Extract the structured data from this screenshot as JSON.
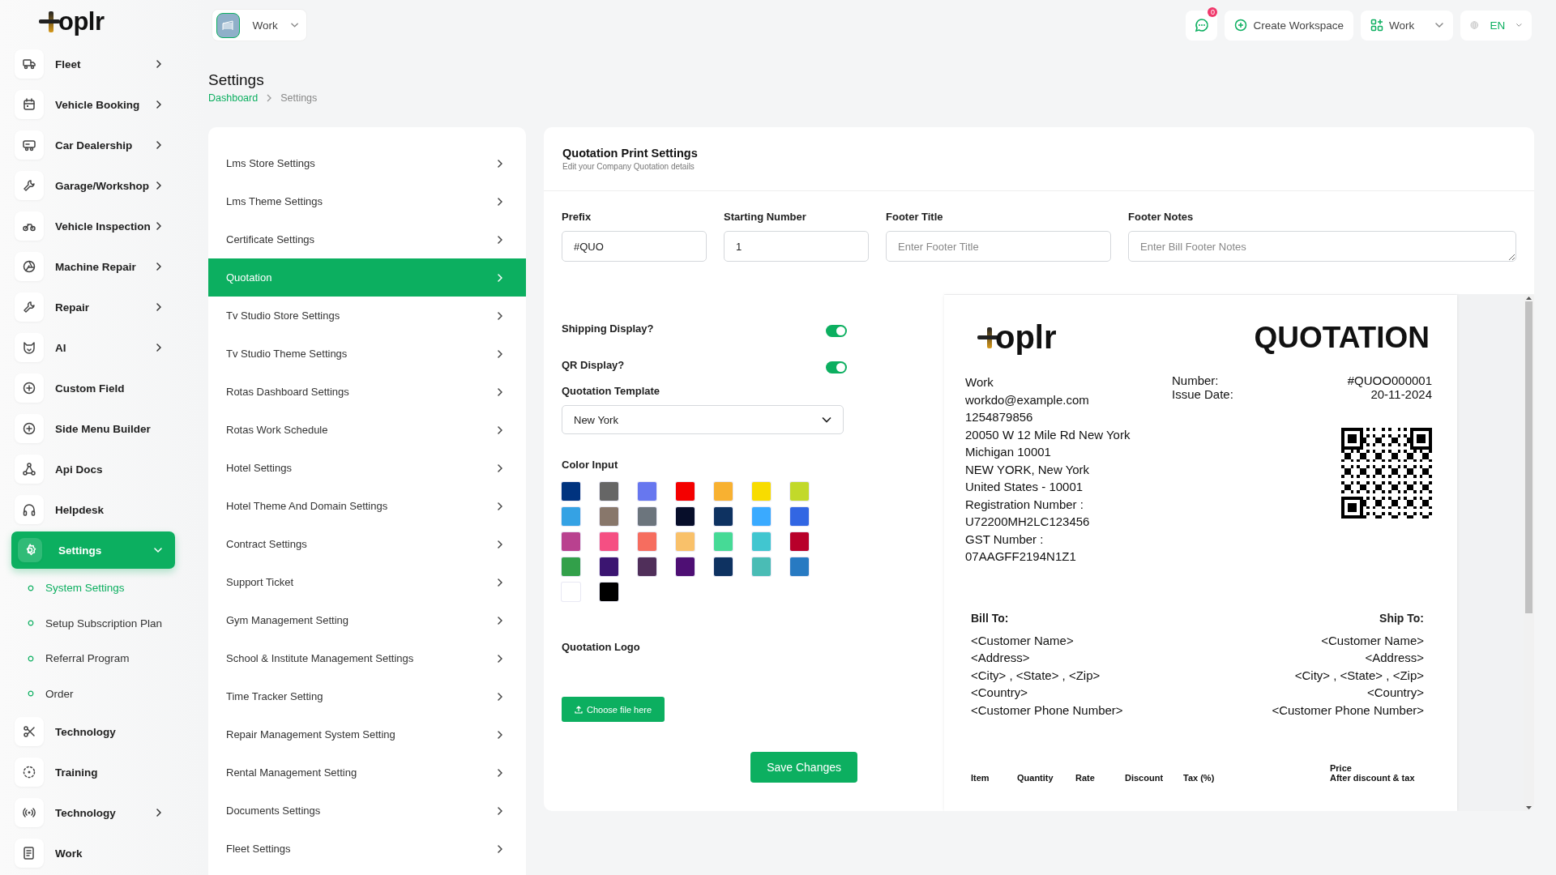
{
  "sidebar": {
    "logo": {
      "text": "oplr"
    },
    "items": [
      {
        "label": "Fleet",
        "kind": "group",
        "selected": false,
        "expanded": false
      },
      {
        "label": "Vehicle Booking",
        "kind": "group",
        "selected": false,
        "expanded": false
      },
      {
        "label": "Car Dealership",
        "kind": "group",
        "selected": false,
        "expanded": false
      },
      {
        "label": "Garage/Workshop",
        "kind": "group",
        "selected": false,
        "expanded": false
      },
      {
        "label": "Vehicle Inspection",
        "kind": "group",
        "selected": false,
        "expanded": false
      },
      {
        "label": "Machine Repair",
        "kind": "group",
        "selected": false,
        "expanded": false
      },
      {
        "label": "Repair",
        "kind": "group",
        "selected": false,
        "expanded": false
      },
      {
        "label": "AI",
        "kind": "group",
        "selected": false,
        "expanded": false
      },
      {
        "label": "Custom Field",
        "kind": "link",
        "selected": false,
        "expanded": false
      },
      {
        "label": "Side Menu Builder",
        "kind": "link",
        "selected": false,
        "expanded": false
      },
      {
        "label": "Api Docs",
        "kind": "link",
        "selected": false,
        "expanded": false
      },
      {
        "label": "Helpdesk",
        "kind": "link",
        "selected": false,
        "expanded": false
      },
      {
        "label": "Settings",
        "kind": "group",
        "selected": true,
        "expanded": true,
        "children": [
          {
            "label": "System Settings",
            "selected": true
          },
          {
            "label": "Setup Subscription Plan",
            "selected": false
          },
          {
            "label": "Referral Program",
            "selected": false
          },
          {
            "label": "Order",
            "selected": false
          }
        ]
      },
      {
        "label": "Technology",
        "kind": "link",
        "selected": false,
        "expanded": false
      },
      {
        "label": "Training",
        "kind": "link",
        "selected": false,
        "expanded": false
      },
      {
        "label": "Technology",
        "kind": "group",
        "selected": false,
        "expanded": false
      },
      {
        "label": "Work",
        "kind": "link",
        "selected": false,
        "expanded": false
      }
    ]
  },
  "top_bar": {
    "workspace": "Work",
    "notifications": "0",
    "create_button": "Create Workspace",
    "workspace_menu": "Work",
    "language": "EN"
  },
  "page": {
    "title": "Settings",
    "breadcrumb": [
      "Dashboard",
      "Settings"
    ]
  },
  "settings_menu": [
    {
      "label": "Lms Store Settings",
      "selected": false
    },
    {
      "label": "Lms Theme Settings",
      "selected": false
    },
    {
      "label": "Certificate Settings",
      "selected": false
    },
    {
      "label": "Quotation",
      "selected": true
    },
    {
      "label": "Tv Studio Store Settings",
      "selected": false
    },
    {
      "label": "Tv Studio Theme Settings",
      "selected": false
    },
    {
      "label": "Rotas Dashboard Settings",
      "selected": false
    },
    {
      "label": "Rotas Work Schedule",
      "selected": false
    },
    {
      "label": "Hotel Settings",
      "selected": false
    },
    {
      "label": "Hotel Theme And Domain Settings",
      "selected": false
    },
    {
      "label": "Contract Settings",
      "selected": false
    },
    {
      "label": "Support Ticket",
      "selected": false
    },
    {
      "label": "Gym Management Setting",
      "selected": false
    },
    {
      "label": "School & Institute Management Settings",
      "selected": false
    },
    {
      "label": "Time Tracker Setting",
      "selected": false
    },
    {
      "label": "Repair Management System Setting",
      "selected": false
    },
    {
      "label": "Rental Management Setting",
      "selected": false
    },
    {
      "label": "Documents Settings",
      "selected": false
    },
    {
      "label": "Fleet Settings",
      "selected": false
    }
  ],
  "card": {
    "title": "Quotation Print Settings",
    "subtitle": "Edit your Company Quotation details",
    "fields": [
      {
        "label": "Prefix",
        "value": "#QUO",
        "kind": "input"
      },
      {
        "label": "Starting Number",
        "value": "1",
        "kind": "input"
      },
      {
        "label": "Footer Title",
        "placeholder": "Enter Footer Title",
        "kind": "input"
      },
      {
        "label": "Footer Notes",
        "placeholder": "Enter Bill Footer Notes",
        "kind": "textarea"
      }
    ],
    "toggles": [
      {
        "label": "Shipping Display?",
        "on": true
      },
      {
        "label": "QR Display?",
        "on": true
      }
    ],
    "template": {
      "label": "Quotation Template",
      "value": "New York"
    },
    "color_input": {
      "label": "Color Input",
      "colors": [
        {
          "color": "#00337f"
        },
        {
          "color": "#666666"
        },
        {
          "color": "#6777ef"
        },
        {
          "color": "#f40000"
        },
        {
          "color": "#f8b131"
        },
        {
          "color": "#f8dc00"
        },
        {
          "color": "#c2d92a"
        },
        {
          "color": "#35a2e4"
        },
        {
          "color": "#88776b"
        },
        {
          "color": "#6c757d"
        },
        {
          "color": "#070e2a"
        },
        {
          "color": "#0e3261"
        },
        {
          "color": "#3aaaff"
        },
        {
          "color": "#3266e3"
        },
        {
          "color": "#b9418f"
        },
        {
          "color": "#f54f83"
        },
        {
          "color": "#f66d5f"
        },
        {
          "color": "#f9c16a"
        },
        {
          "color": "#46da96"
        },
        {
          "color": "#41c6d0"
        },
        {
          "color": "#b8002a"
        },
        {
          "color": "#32a04a"
        },
        {
          "color": "#3b1571"
        },
        {
          "color": "#502f5a"
        },
        {
          "color": "#4e0f74"
        },
        {
          "color": "#0e3261"
        },
        {
          "color": "#4abcb5"
        },
        {
          "color": "#287ac2"
        },
        {
          "color": "#ffffff"
        },
        {
          "color": "#000000"
        }
      ]
    },
    "logo": {
      "label": "Quotation Logo",
      "button": "Choose file here"
    },
    "save_button": "Save Changes"
  },
  "preview": {
    "logo": {
      "text": "oplr"
    },
    "title": "QUOTATION",
    "company": [
      "Work",
      "workdo@example.com",
      "1254879856",
      "20050 W 12 Mile Rd New York",
      "Michigan 10001",
      "NEW YORK, New York",
      "United States - 10001",
      "Registration Number :",
      "U72200MH2LC123456",
      "GST Number :",
      "07AAGFF2194N1Z1"
    ],
    "meta": [
      {
        "label": "Number:",
        "value": "#QUOO000001"
      },
      {
        "label": "Issue Date:",
        "value": "20-11-2024"
      }
    ],
    "bill_to": {
      "title": "Bill To:",
      "lines": [
        "<Customer Name>",
        "<Address>",
        "<City> , <State> , <Zip>",
        "<Country>",
        "<Customer Phone Number>"
      ]
    },
    "ship_to": {
      "title": "Ship To:",
      "lines": [
        "<Customer Name>",
        "<Address>",
        "<City> , <State> , <Zip>",
        "<Country>",
        "<Customer Phone Number>"
      ]
    },
    "columns": [
      {
        "label": "Item"
      },
      {
        "label": "Quantity"
      },
      {
        "label": "Rate"
      },
      {
        "label": "Discount"
      },
      {
        "label": "Tax (%)"
      },
      {
        "label": "Price",
        "sub": "After discount & tax"
      }
    ]
  }
}
